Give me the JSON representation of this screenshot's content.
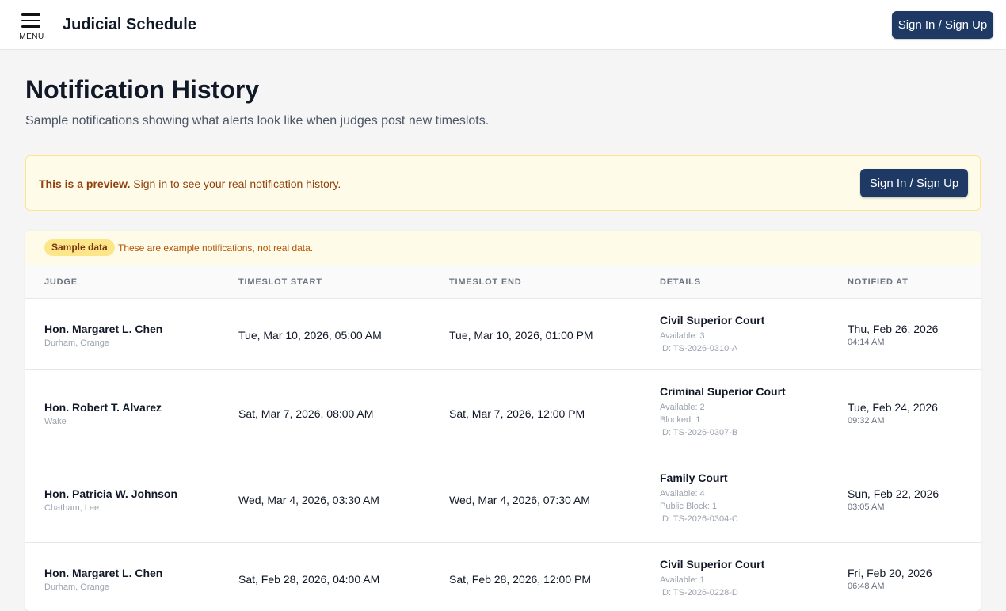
{
  "header": {
    "menu_label": "MENU",
    "app_title": "Judicial Schedule",
    "signin_label": "Sign In / Sign Up"
  },
  "page": {
    "title": "Notification History",
    "subtitle": "Sample notifications showing what alerts look like when judges post new timeslots."
  },
  "preview_banner": {
    "bold_text": "This is a preview.",
    "text": " Sign in to see your real notification history.",
    "signin_label": "Sign In / Sign Up"
  },
  "table": {
    "sample_badge": "Sample data",
    "sample_note": "These are example notifications, not real data.",
    "columns": [
      "JUDGE",
      "TIMESLOT START",
      "TIMESLOT END",
      "DETAILS",
      "NOTIFIED AT"
    ],
    "rows": [
      {
        "judge": "Hon. Margaret L. Chen",
        "county": "Durham, Orange",
        "start": "Tue, Mar 10, 2026, 05:00 AM",
        "end": "Tue, Mar 10, 2026, 01:00 PM",
        "court": "Civil Superior Court",
        "details": [
          "Available: 3"
        ],
        "id": "ID: TS-2026-0310-A",
        "notified_date": "Thu, Feb 26, 2026",
        "notified_time": "04:14 AM"
      },
      {
        "judge": "Hon. Robert T. Alvarez",
        "county": "Wake",
        "start": "Sat, Mar 7, 2026, 08:00 AM",
        "end": "Sat, Mar 7, 2026, 12:00 PM",
        "court": "Criminal Superior Court",
        "details": [
          "Available: 2",
          "Blocked: 1"
        ],
        "id": "ID: TS-2026-0307-B",
        "notified_date": "Tue, Feb 24, 2026",
        "notified_time": "09:32 AM"
      },
      {
        "judge": "Hon. Patricia W. Johnson",
        "county": "Chatham, Lee",
        "start": "Wed, Mar 4, 2026, 03:30 AM",
        "end": "Wed, Mar 4, 2026, 07:30 AM",
        "court": "Family Court",
        "details": [
          "Available: 4",
          "Public Block: 1"
        ],
        "id": "ID: TS-2026-0304-C",
        "notified_date": "Sun, Feb 22, 2026",
        "notified_time": "03:05 AM"
      },
      {
        "judge": "Hon. Margaret L. Chen",
        "county": "Durham, Orange",
        "start": "Sat, Feb 28, 2026, 04:00 AM",
        "end": "Sat, Feb 28, 2026, 12:00 PM",
        "court": "Civil Superior Court",
        "details": [
          "Available: 1"
        ],
        "id": "ID: TS-2026-0228-D",
        "notified_date": "Fri, Feb 20, 2026",
        "notified_time": "06:48 AM"
      }
    ]
  },
  "colors": {
    "primary": "#1e3a64",
    "banner_bg": "#fefce8",
    "banner_border": "#fde68a",
    "banner_text": "#92400e"
  }
}
